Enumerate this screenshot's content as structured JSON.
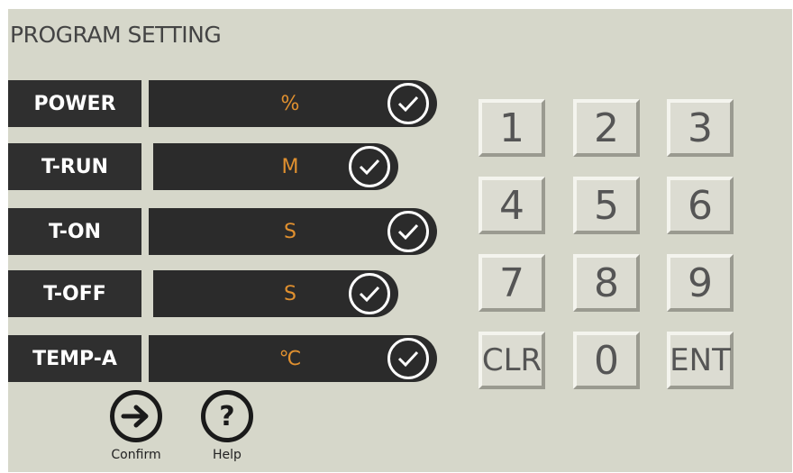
{
  "title": "PROGRAM SETTING",
  "rows": [
    {
      "label": "POWER",
      "unit": "%"
    },
    {
      "label": "T-RUN",
      "unit": "M"
    },
    {
      "label": "T-ON",
      "unit": "S"
    },
    {
      "label": "T-OFF",
      "unit": "S"
    },
    {
      "label": "TEMP-A",
      "unit": "℃"
    }
  ],
  "keypad": [
    "1",
    "2",
    "3",
    "4",
    "5",
    "6",
    "7",
    "8",
    "9",
    "CLR",
    "0",
    "ENT"
  ],
  "actions": {
    "confirm_label": "Confirm",
    "help_label": "Help",
    "help_symbol": "?"
  },
  "colors": {
    "background": "#d6d7ca",
    "field": "#2b2b2b",
    "unit_text": "#e0902f"
  }
}
